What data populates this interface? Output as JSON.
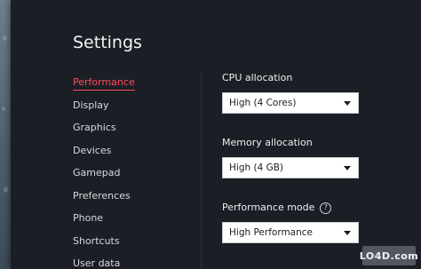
{
  "window": {
    "title": "Settings"
  },
  "sidebar": {
    "items": [
      {
        "label": "Performance",
        "active": true
      },
      {
        "label": "Display",
        "active": false
      },
      {
        "label": "Graphics",
        "active": false
      },
      {
        "label": "Devices",
        "active": false
      },
      {
        "label": "Gamepad",
        "active": false
      },
      {
        "label": "Preferences",
        "active": false
      },
      {
        "label": "Phone",
        "active": false
      },
      {
        "label": "Shortcuts",
        "active": false
      },
      {
        "label": "User data",
        "active": false
      }
    ]
  },
  "performance": {
    "cpu": {
      "label": "CPU allocation",
      "value": "High (4 Cores)"
    },
    "memory": {
      "label": "Memory allocation",
      "value": "High (4 GB)"
    },
    "mode": {
      "label": "Performance mode",
      "value": "High Performance"
    }
  },
  "icons": {
    "help": "help-circle-icon",
    "dropdown": "chevron-down-icon"
  },
  "colors": {
    "accent": "#ff4a5c",
    "window_bg": "#1c1e25",
    "text": "#eceef1"
  },
  "watermark": {
    "logo_text": "LO4D.com"
  }
}
